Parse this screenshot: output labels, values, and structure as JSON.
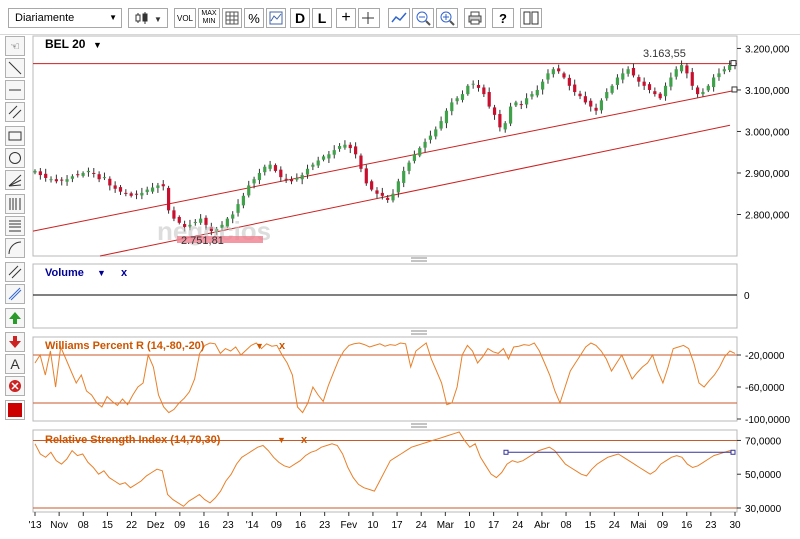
{
  "toolbar": {
    "period": "Diariamente",
    "vol_label": "VOL",
    "maxmin_top": "MAX",
    "maxmin_bottom": "MIN",
    "percent_label": "%",
    "d_label": "D",
    "l_label": "L",
    "help_label": "?"
  },
  "sidebar": {
    "text_tool_label": "A"
  },
  "colors": {
    "up": "#3fa24a",
    "down": "#c8102e",
    "trend": "#cc2020",
    "indicator": "#e8802a",
    "indicator_title": "#cc5500",
    "volume_title": "#000099"
  },
  "chart_data": [
    {
      "type": "candlestick",
      "title": "BEL 20",
      "ylim": [
        2700,
        3230
      ],
      "yticks": [
        "3.200,000",
        "3.100,000",
        "3.000,000",
        "2.900,000",
        "2.800,000"
      ],
      "ytick_values": [
        3200,
        3100,
        3000,
        2900,
        2800
      ],
      "annotations": [
        {
          "label": "3.163,55",
          "value": 3163.55
        },
        {
          "label": "2.751,81",
          "value": 2751.81
        }
      ],
      "watermark": "negocios",
      "last_value": 3163.55,
      "close_path": [
        2905,
        2895,
        2888,
        2885,
        2880,
        2882,
        2885,
        2892,
        2895,
        2900,
        2905,
        2898,
        2885,
        2890,
        2870,
        2862,
        2855,
        2850,
        2845,
        2848,
        2852,
        2860,
        2865,
        2870,
        2868,
        2810,
        2790,
        2780,
        2770,
        2775,
        2782,
        2790,
        2775,
        2760,
        2765,
        2775,
        2790,
        2800,
        2825,
        2845,
        2870,
        2885,
        2900,
        2915,
        2920,
        2905,
        2890,
        2885,
        2880,
        2888,
        2895,
        2910,
        2920,
        2930,
        2940,
        2945,
        2955,
        2965,
        2968,
        2960,
        2945,
        2910,
        2875,
        2860,
        2850,
        2845,
        2835,
        2850,
        2880,
        2905,
        2925,
        2945,
        2960,
        2975,
        2990,
        3005,
        3025,
        3050,
        3070,
        3080,
        3090,
        3110,
        3115,
        3105,
        3090,
        3060,
        3040,
        3010,
        3020,
        3060,
        3070,
        3065,
        3080,
        3090,
        3100,
        3120,
        3140,
        3150,
        3145,
        3130,
        3110,
        3095,
        3085,
        3070,
        3060,
        3050,
        3075,
        3095,
        3110,
        3130,
        3140,
        3150,
        3135,
        3120,
        3110,
        3100,
        3090,
        3080,
        3110,
        3130,
        3150,
        3160,
        3140,
        3110,
        3090,
        3095,
        3110,
        3130,
        3140,
        3150,
        3160,
        3163
      ],
      "x_labels": [
        "'13",
        "Nov",
        "08",
        "15",
        "22",
        "Dez",
        "09",
        "16",
        "23",
        "'14",
        "09",
        "16",
        "23",
        "Fev",
        "10",
        "17",
        "24",
        "Mar",
        "10",
        "17",
        "24",
        "Abr",
        "08",
        "15",
        "24",
        "Mai",
        "09",
        "16",
        "23",
        "30"
      ]
    },
    {
      "type": "bar",
      "title": "Volume",
      "yticks": [
        "0"
      ],
      "ytick_values": [
        0
      ],
      "values": []
    },
    {
      "type": "line",
      "title": "Williams Percent R (14,-80,-20)",
      "ylim": [
        -100,
        0
      ],
      "yticks": [
        "-20,0000",
        "-60,0000",
        "-100,0000"
      ],
      "ytick_values": [
        -20,
        -60,
        -100
      ],
      "levels": [
        -20,
        -80
      ],
      "values": [
        -30,
        -20,
        -45,
        -15,
        -60,
        -10,
        -25,
        -40,
        -55,
        -45,
        -65,
        -70,
        -80,
        -85,
        -72,
        -78,
        -83,
        -75,
        -82,
        -70,
        -60,
        -55,
        -20,
        -35,
        -70,
        -85,
        -92,
        -88,
        -80,
        -74,
        -66,
        -50,
        -18,
        -8,
        -5,
        -6,
        -18,
        -12,
        -15,
        -10,
        -20,
        -14,
        -8,
        -5,
        -12,
        -6,
        -9,
        -8,
        -20,
        -30,
        -45,
        -85,
        -92,
        -80,
        -60,
        -70,
        -78,
        -58,
        -42,
        -26,
        -15,
        -8,
        -6,
        -5,
        -7,
        -10,
        -8,
        -6,
        -9,
        -7,
        -8,
        -5,
        -6,
        -35,
        -15,
        -10,
        -5,
        -25,
        -40,
        -55,
        -82,
        -80,
        -60,
        -20,
        -8,
        -15,
        -30,
        -22,
        -12,
        -16,
        -18,
        -12,
        -25,
        -10,
        -9,
        -7,
        -8,
        -5,
        -15,
        -30,
        -45,
        -65,
        -80,
        -60,
        -40,
        -30,
        -20,
        -10,
        -5,
        -8,
        -15,
        -25,
        -40,
        -30,
        -20,
        -35,
        -50,
        -42,
        -35,
        -30,
        -20,
        -40,
        -55,
        -35,
        -12,
        -10,
        -8,
        -12,
        -30,
        -55,
        -60,
        -52,
        -45,
        -35,
        -22,
        -15,
        -18
      ]
    },
    {
      "type": "line",
      "title": "Relative Strength Index (14,70,30)",
      "ylim": [
        30,
        75
      ],
      "yticks": [
        "70,0000",
        "50,0000",
        "30,0000"
      ],
      "ytick_values": [
        70,
        50,
        30
      ],
      "levels": [
        70,
        30
      ],
      "values": [
        68,
        62,
        60,
        63,
        58,
        56,
        59,
        64,
        61,
        62,
        57,
        54,
        50,
        52,
        48,
        46,
        44,
        45,
        42,
        44,
        46,
        49,
        51,
        53,
        52,
        38,
        35,
        33,
        31,
        34,
        36,
        38,
        35,
        33,
        36,
        40,
        46,
        50,
        56,
        60,
        62,
        64,
        66,
        67,
        64,
        60,
        57,
        55,
        54,
        56,
        58,
        61,
        63,
        64,
        66,
        67,
        68,
        67,
        62,
        54,
        48,
        44,
        42,
        41,
        40,
        46,
        52,
        58,
        60,
        62,
        64,
        66,
        67,
        68,
        69,
        70,
        71,
        72,
        73,
        74,
        75,
        70,
        66,
        68,
        60,
        55,
        50,
        48,
        51,
        56,
        58,
        57,
        58,
        60,
        62,
        64,
        65,
        66,
        64,
        60,
        56,
        54,
        52,
        50,
        49,
        53,
        56,
        58,
        60,
        61,
        62,
        60,
        58,
        56,
        54,
        52,
        50,
        52,
        56,
        58,
        60,
        61,
        60,
        56,
        54,
        55,
        57,
        59,
        61,
        62,
        63,
        64,
        63
      ]
    }
  ]
}
